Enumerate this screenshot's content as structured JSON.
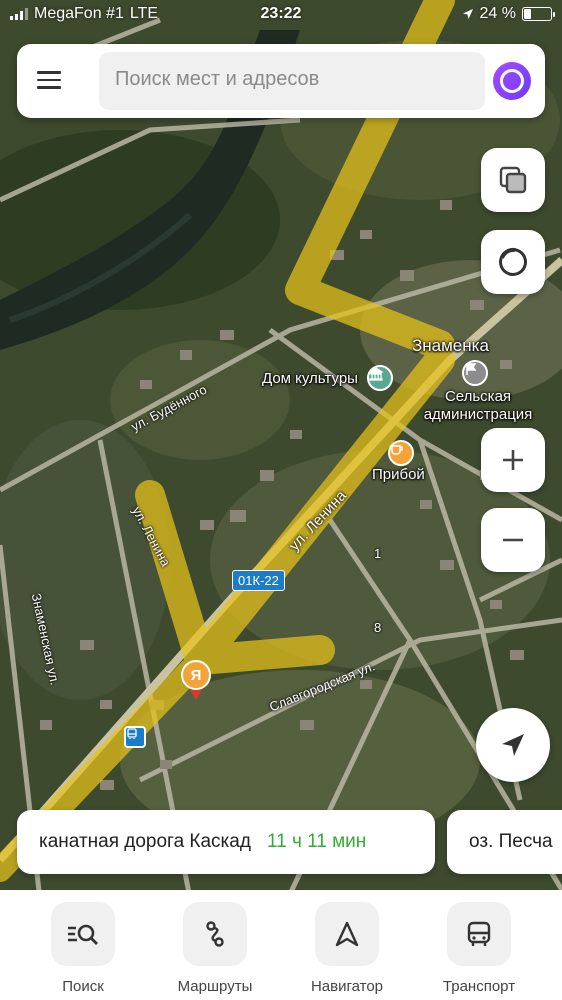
{
  "status_bar": {
    "carrier": "MegaFon #1",
    "network": "LTE",
    "time": "23:22",
    "battery": "24 %",
    "battery_level": 0.24
  },
  "search": {
    "placeholder": "Поиск мест и адресов"
  },
  "map": {
    "places": {
      "village": "Знаменка",
      "culture_house": "Дом культуры",
      "administration": "Сельская администрация",
      "cafe": "Прибой"
    },
    "streets": {
      "budennogo": "ул. Будённого",
      "lenina_main": "ул. Ленина",
      "lenina_side": "ул. Ленина",
      "znamenskaya": "Знаменская ул.",
      "slavgorodskaya": "Славгородская ул.",
      "route_badge": "01К-22"
    },
    "house_numbers": [
      "1",
      "8"
    ],
    "colors": {
      "traffic": "#e8c31a",
      "poi_culture": "#5aa88f",
      "poi_cafe": "#f2a43a",
      "route_badge": "#1c7cc9"
    }
  },
  "suggestions": [
    {
      "name": "канатная дорога Каскад",
      "eta": "11 ч 11 мин"
    },
    {
      "name": "оз. Песча",
      "eta": ""
    }
  ],
  "bottom_nav": {
    "items": [
      {
        "label": "Поиск",
        "icon": "search-list-icon"
      },
      {
        "label": "Маршруты",
        "icon": "routes-icon"
      },
      {
        "label": "Навигатор",
        "icon": "navigator-arrow-icon"
      },
      {
        "label": "Транспорт",
        "icon": "bus-icon"
      }
    ]
  }
}
